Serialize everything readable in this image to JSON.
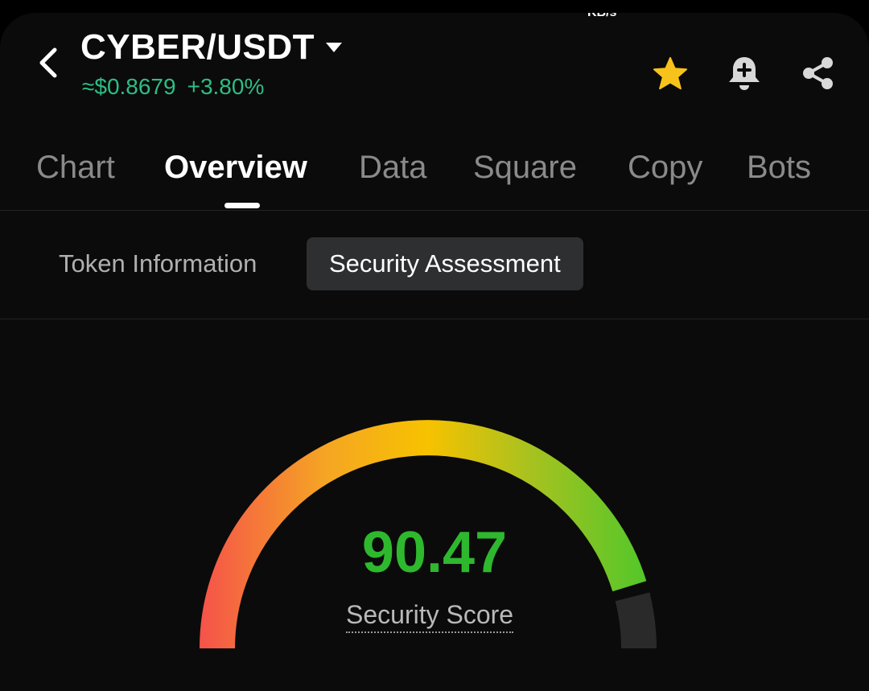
{
  "status_bar": {
    "fragment": "KB/s"
  },
  "header": {
    "pair": "CYBER/USDT",
    "price": "≈$0.8679",
    "change": "+3.80%",
    "icons": [
      "back-arrow-icon",
      "star-icon",
      "bell-plus-icon",
      "share-icon"
    ],
    "favorite": true
  },
  "tabs": [
    {
      "label": "Chart"
    },
    {
      "label": "Overview",
      "active": true
    },
    {
      "label": "Data"
    },
    {
      "label": "Square"
    },
    {
      "label": "Copy"
    },
    {
      "label": "Bots"
    }
  ],
  "subtabs": [
    {
      "label": "Token Information"
    },
    {
      "label": "Security Assessment",
      "active": true
    }
  ],
  "security": {
    "score": "90.47",
    "score_fraction": 0.9047,
    "label": "Security Score",
    "gauge_colors": [
      "#f5524a",
      "#f5a623",
      "#f7c200",
      "#a9c21f",
      "#4cc72b"
    ],
    "track_color": "#2a2a2a"
  },
  "colors": {
    "up": "#2ebd85",
    "score": "#2eb82e",
    "star": "#f7c21a",
    "background": "#0b0b0b"
  }
}
